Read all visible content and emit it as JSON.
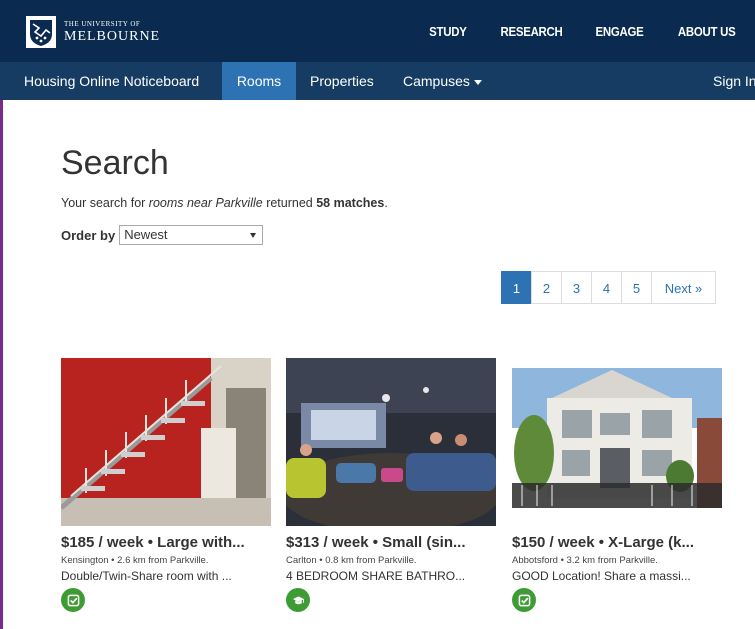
{
  "header": {
    "logo_small": "THE UNIVERSITY OF",
    "logo_big": "MELBOURNE",
    "nav": [
      "STUDY",
      "RESEARCH",
      "ENGAGE",
      "ABOUT US"
    ]
  },
  "subnav": {
    "brand": "Housing Online Noticeboard",
    "tabs": [
      "Rooms",
      "Properties",
      "Campuses"
    ],
    "active_tab": "Rooms",
    "sign_in": "Sign In"
  },
  "search": {
    "title": "Search",
    "summary_prefix": "Your search for ",
    "summary_query": "rooms near Parkville",
    "summary_middle": " returned ",
    "summary_count": "58 matches",
    "summary_suffix": ".",
    "order_label": "Order by",
    "order_value": "Newest"
  },
  "pagination": {
    "pages": [
      "1",
      "2",
      "3",
      "4",
      "5"
    ],
    "current": "1",
    "next": "Next »"
  },
  "listings": [
    {
      "price": "$185 / week • Large with...",
      "location": "Kensington • 2.6 km from Parkville.",
      "description": "Double/Twin-Share room with ...",
      "badge_icon": "checkbox-icon",
      "photo": "staircase-interior-photo"
    },
    {
      "price": "$313 / week • Small (sin...",
      "location": "Carlton • 0.8 km from Parkville.",
      "description": "4 BEDROOM SHARE BATHRO...",
      "badge_icon": "graduation-cap-icon",
      "photo": "student-lounge-photo"
    },
    {
      "price": "$150 / week • X-Large (k...",
      "location": "Abbotsford • 3.2 km from Parkville.",
      "description": "GOOD Location! Share a massi...",
      "badge_icon": "checkbox-icon",
      "photo": "house-exterior-photo"
    }
  ],
  "colors": {
    "topbar": "#0b2a4f",
    "subnav": "#163c63",
    "accent": "#2d73b3",
    "badge": "#3f9c35"
  }
}
